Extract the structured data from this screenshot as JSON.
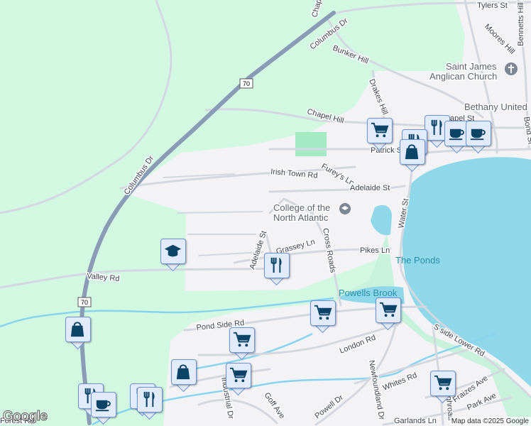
{
  "map": {
    "highway": {
      "name": "Columbus Dr",
      "route": "70"
    },
    "roads": [
      "Chapel Hill",
      "Bunker Hill",
      "Drakes Hill",
      "Moores Hill",
      "Bennetts Hill",
      "Tylers St",
      "Chapel Hill",
      "Patrick St",
      "Chapel St",
      "Bond St",
      "Irish Town Rd",
      "Furey's Ln",
      "Adelaide St",
      "Adelaide St",
      "Grassey Ln",
      "Cross Roads",
      "Pikes Ln",
      "Water St",
      "Valley Rd",
      "Pond Side Rd",
      "London Rd",
      "S side Lower Rd",
      "Whites Rd",
      "Fraizes Ave",
      "Park Ave",
      "Powell Dr",
      "Garlands Ln",
      "Newfoundland Dr",
      "Goff Ave",
      "Industrial Dr",
      "Forest Rd",
      "Highroad"
    ],
    "places": {
      "church": "Saint James Anglican Church",
      "church_line1": "Saint James",
      "church_line2": "Anglican Church",
      "bethany": "Bethany United",
      "college_line1": "College of the",
      "college_line2": "North Atlantic",
      "ponds": "The Ponds",
      "brook": "Powells Brook"
    },
    "markers": [
      "grocery",
      "restaurant",
      "restaurant",
      "shopping",
      "cafe",
      "cafe",
      "education",
      "restaurant",
      "grocery",
      "grocery",
      "grocery",
      "shopping",
      "grocery",
      "grocery",
      "shopping",
      "restaurant",
      "cafe",
      "restaurant",
      "restaurant"
    ],
    "colors": {
      "park": "#d3f8e2",
      "urban": "#f3f2f4",
      "water": "#8fd8ea",
      "highway": "#8a9bb5",
      "marker_icon": "#0b4466"
    }
  },
  "footer": {
    "logo": "Google",
    "attribution": "Map data ©2025 Google"
  }
}
